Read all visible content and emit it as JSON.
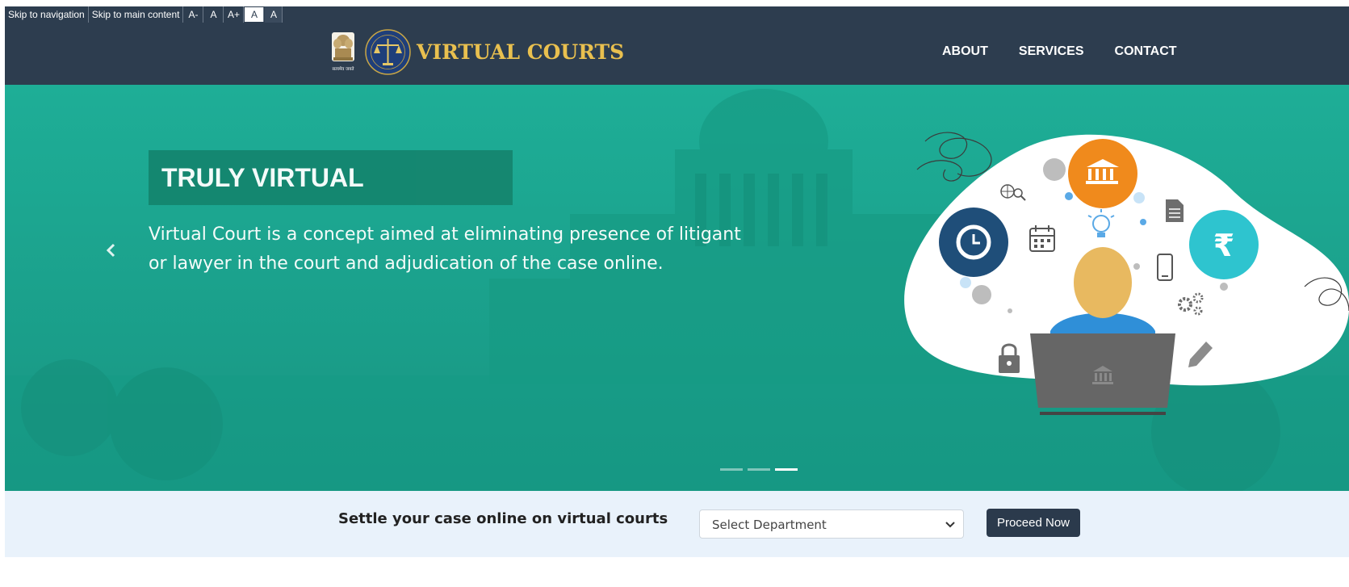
{
  "accessibility": {
    "skip_nav": "Skip to navigation",
    "skip_main": "Skip to main content",
    "font_decrease": "A-",
    "font_normal": "A",
    "font_increase": "A+",
    "theme_light": "A",
    "theme_dark": "A"
  },
  "header": {
    "brand": "VIRTUAL COURTS",
    "emblem_caption": "सत्यमेव जयते",
    "nav": [
      "ABOUT",
      "SERVICES",
      "CONTACT"
    ]
  },
  "hero": {
    "headline": "TRULY VIRTUAL",
    "description": "Virtual Court is a concept aimed at eliminating presence of litigant or lawyer in the court and adjudication of the case online.",
    "slides_total": 3,
    "active_slide": 3
  },
  "settle": {
    "text": "Settle your case online on virtual courts",
    "select_value": "Select Department",
    "button": "Proceed Now"
  },
  "colors": {
    "header_bg": "#2d3d4f",
    "hero_bg": "#1aa58e",
    "brand_text": "#e9c04f",
    "settle_bg": "#e9f2fb",
    "button_bg": "#2b3a4c"
  },
  "icons": [
    "national-emblem-icon",
    "court-seal-icon",
    "chevron-left-icon",
    "chevron-down-icon",
    "bank-icon",
    "clock-icon",
    "rupee-icon",
    "calendar-icon",
    "lightbulb-icon",
    "document-icon",
    "phone-icon",
    "gears-icon",
    "lock-icon",
    "pencil-icon",
    "globe-search-icon",
    "laptop-icon"
  ]
}
